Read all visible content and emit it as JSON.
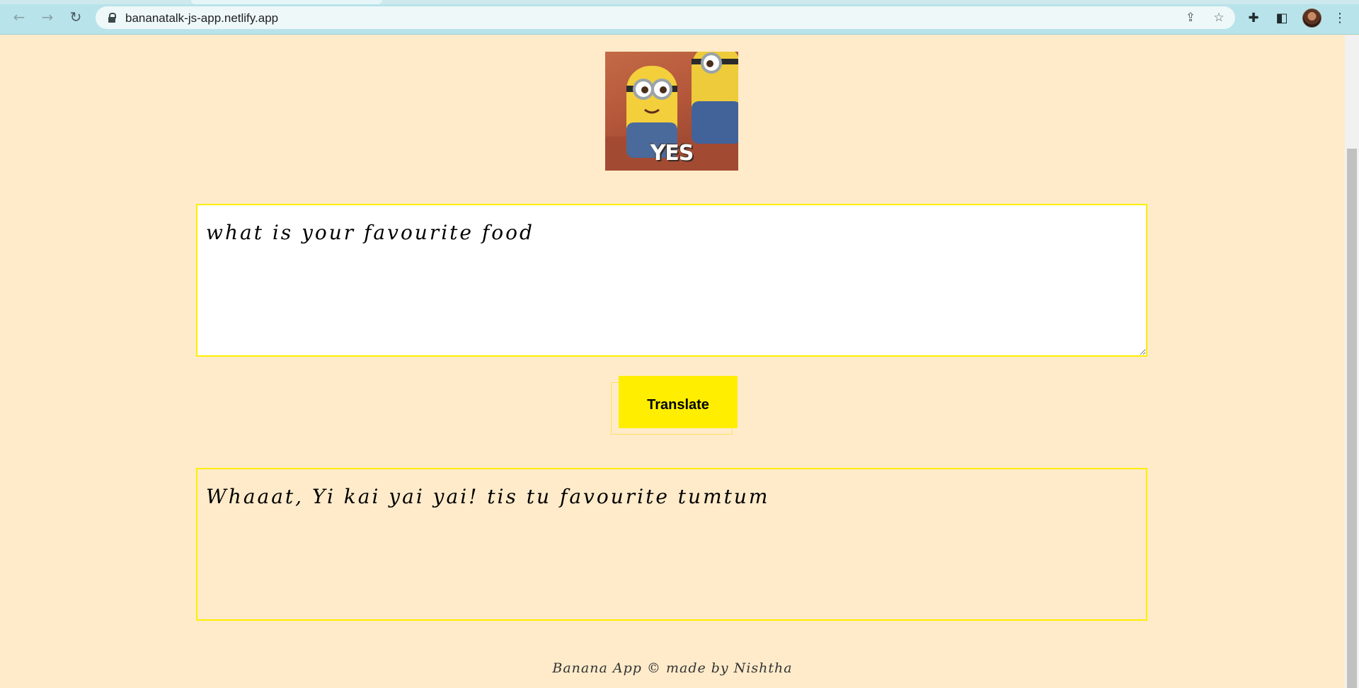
{
  "browser": {
    "url": "bananatalk-js-app.netlify.app",
    "icons": {
      "back": "back-arrow-icon",
      "forward": "forward-arrow-icon",
      "reload": "reload-icon",
      "lock": "lock-icon",
      "share": "share-icon",
      "bookmark": "star-icon",
      "extensions": "puzzle-icon",
      "side_panel": "side-panel-icon",
      "profile": "avatar",
      "menu": "kebab-menu-icon"
    }
  },
  "page": {
    "gif_caption": "YES",
    "input_text": "what is your favourite food",
    "translate_label": "Translate",
    "output_text": "Whaaat, Yi kai yai yai! tis tu favourite tumtum",
    "footer": "Banana App © made by Nishtha"
  },
  "colors": {
    "page_bg": "#ffebca",
    "accent_yellow": "#ffee00",
    "chrome_bg": "#b9e3ea"
  }
}
